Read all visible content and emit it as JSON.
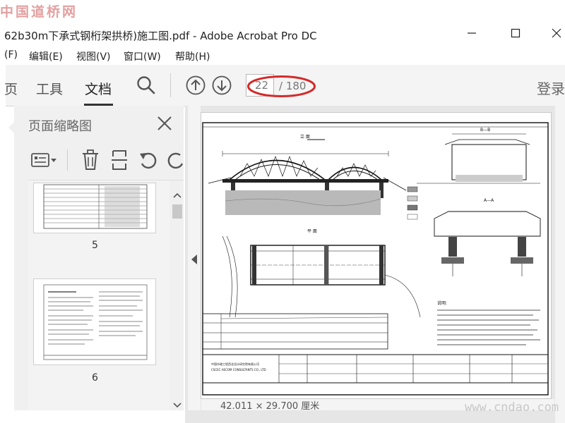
{
  "watermark_top": "中国道桥网",
  "watermark_bottom": "www.cndao.com",
  "window": {
    "title": "62b30m下承式钢桁架拱桥)施工图.pdf - Adobe Acrobat Pro DC"
  },
  "menu": [
    "(F)",
    "编辑(E)",
    "视图(V)",
    "窗口(W)",
    "帮助(H)"
  ],
  "toolbar": {
    "tabs": [
      "页",
      "工具",
      "文档"
    ],
    "active_tab": "文档",
    "page_number": "22",
    "page_total": "/ 180",
    "signin_label": "登录"
  },
  "panel": {
    "title": "页面缩略图",
    "thumbnails": [
      {
        "label": "5"
      },
      {
        "label": "6"
      }
    ]
  },
  "drawing": {
    "titles": [
      "立 面",
      "B—B",
      "平 面",
      "A—A"
    ],
    "notes_title": "说明:",
    "company_cn": "中国市政工程西北设计研究院有限公司",
    "company_en": "CSCEC AECOM CONSULTANTS CO., LTD",
    "bottom_note": "中国市政工程西北设计研究院有限公司"
  },
  "status": {
    "text": "42.011 × 29.700 厘米"
  },
  "colors": {
    "accent_red": "#d42a2a",
    "toolbar_bg": "#f4f4f4",
    "panel_bg": "#f0f0f0"
  }
}
